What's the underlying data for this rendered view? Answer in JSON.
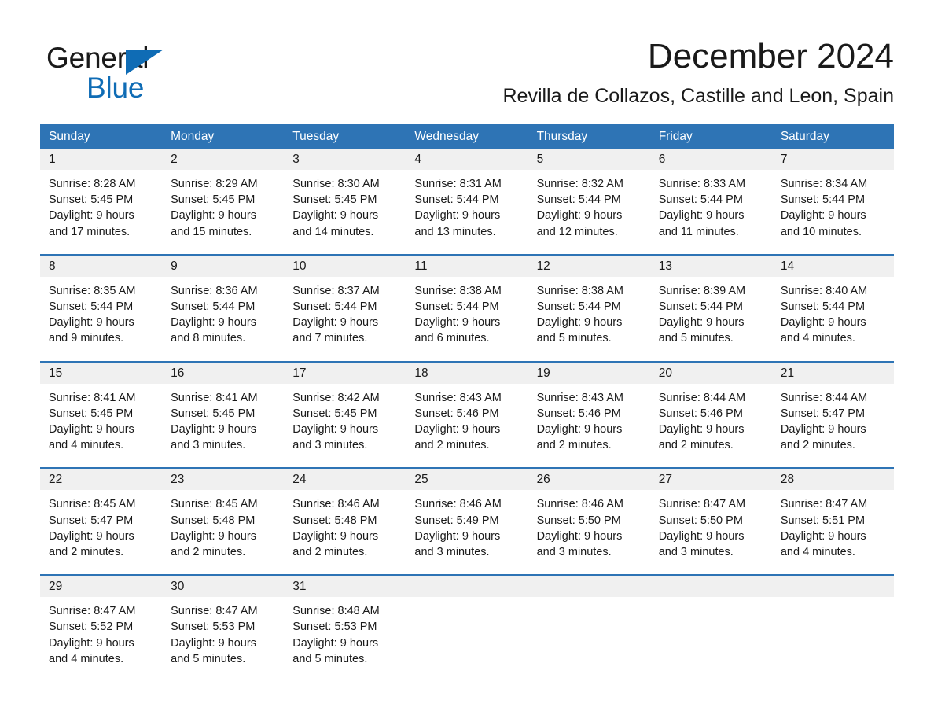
{
  "brand": {
    "name_part1": "General",
    "name_part2": "Blue",
    "triangle_icon": "blue-triangle-icon",
    "accent_color": "#0f6cb5"
  },
  "header": {
    "title": "December 2024",
    "subtitle": "Revilla de Collazos, Castille and Leon, Spain"
  },
  "colors": {
    "header_blue": "#2e74b5",
    "day_band_gray": "#f0f0f0",
    "text": "#1a1a1a",
    "header_text": "#ffffff"
  },
  "calendar": {
    "weekdays": [
      "Sunday",
      "Monday",
      "Tuesday",
      "Wednesday",
      "Thursday",
      "Friday",
      "Saturday"
    ],
    "weeks": [
      [
        {
          "day": "1",
          "sunrise": "Sunrise: 8:28 AM",
          "sunset": "Sunset: 5:45 PM",
          "daylight1": "Daylight: 9 hours",
          "daylight2": "and 17 minutes."
        },
        {
          "day": "2",
          "sunrise": "Sunrise: 8:29 AM",
          "sunset": "Sunset: 5:45 PM",
          "daylight1": "Daylight: 9 hours",
          "daylight2": "and 15 minutes."
        },
        {
          "day": "3",
          "sunrise": "Sunrise: 8:30 AM",
          "sunset": "Sunset: 5:45 PM",
          "daylight1": "Daylight: 9 hours",
          "daylight2": "and 14 minutes."
        },
        {
          "day": "4",
          "sunrise": "Sunrise: 8:31 AM",
          "sunset": "Sunset: 5:44 PM",
          "daylight1": "Daylight: 9 hours",
          "daylight2": "and 13 minutes."
        },
        {
          "day": "5",
          "sunrise": "Sunrise: 8:32 AM",
          "sunset": "Sunset: 5:44 PM",
          "daylight1": "Daylight: 9 hours",
          "daylight2": "and 12 minutes."
        },
        {
          "day": "6",
          "sunrise": "Sunrise: 8:33 AM",
          "sunset": "Sunset: 5:44 PM",
          "daylight1": "Daylight: 9 hours",
          "daylight2": "and 11 minutes."
        },
        {
          "day": "7",
          "sunrise": "Sunrise: 8:34 AM",
          "sunset": "Sunset: 5:44 PM",
          "daylight1": "Daylight: 9 hours",
          "daylight2": "and 10 minutes."
        }
      ],
      [
        {
          "day": "8",
          "sunrise": "Sunrise: 8:35 AM",
          "sunset": "Sunset: 5:44 PM",
          "daylight1": "Daylight: 9 hours",
          "daylight2": "and 9 minutes."
        },
        {
          "day": "9",
          "sunrise": "Sunrise: 8:36 AM",
          "sunset": "Sunset: 5:44 PM",
          "daylight1": "Daylight: 9 hours",
          "daylight2": "and 8 minutes."
        },
        {
          "day": "10",
          "sunrise": "Sunrise: 8:37 AM",
          "sunset": "Sunset: 5:44 PM",
          "daylight1": "Daylight: 9 hours",
          "daylight2": "and 7 minutes."
        },
        {
          "day": "11",
          "sunrise": "Sunrise: 8:38 AM",
          "sunset": "Sunset: 5:44 PM",
          "daylight1": "Daylight: 9 hours",
          "daylight2": "and 6 minutes."
        },
        {
          "day": "12",
          "sunrise": "Sunrise: 8:38 AM",
          "sunset": "Sunset: 5:44 PM",
          "daylight1": "Daylight: 9 hours",
          "daylight2": "and 5 minutes."
        },
        {
          "day": "13",
          "sunrise": "Sunrise: 8:39 AM",
          "sunset": "Sunset: 5:44 PM",
          "daylight1": "Daylight: 9 hours",
          "daylight2": "and 5 minutes."
        },
        {
          "day": "14",
          "sunrise": "Sunrise: 8:40 AM",
          "sunset": "Sunset: 5:44 PM",
          "daylight1": "Daylight: 9 hours",
          "daylight2": "and 4 minutes."
        }
      ],
      [
        {
          "day": "15",
          "sunrise": "Sunrise: 8:41 AM",
          "sunset": "Sunset: 5:45 PM",
          "daylight1": "Daylight: 9 hours",
          "daylight2": "and 4 minutes."
        },
        {
          "day": "16",
          "sunrise": "Sunrise: 8:41 AM",
          "sunset": "Sunset: 5:45 PM",
          "daylight1": "Daylight: 9 hours",
          "daylight2": "and 3 minutes."
        },
        {
          "day": "17",
          "sunrise": "Sunrise: 8:42 AM",
          "sunset": "Sunset: 5:45 PM",
          "daylight1": "Daylight: 9 hours",
          "daylight2": "and 3 minutes."
        },
        {
          "day": "18",
          "sunrise": "Sunrise: 8:43 AM",
          "sunset": "Sunset: 5:46 PM",
          "daylight1": "Daylight: 9 hours",
          "daylight2": "and 2 minutes."
        },
        {
          "day": "19",
          "sunrise": "Sunrise: 8:43 AM",
          "sunset": "Sunset: 5:46 PM",
          "daylight1": "Daylight: 9 hours",
          "daylight2": "and 2 minutes."
        },
        {
          "day": "20",
          "sunrise": "Sunrise: 8:44 AM",
          "sunset": "Sunset: 5:46 PM",
          "daylight1": "Daylight: 9 hours",
          "daylight2": "and 2 minutes."
        },
        {
          "day": "21",
          "sunrise": "Sunrise: 8:44 AM",
          "sunset": "Sunset: 5:47 PM",
          "daylight1": "Daylight: 9 hours",
          "daylight2": "and 2 minutes."
        }
      ],
      [
        {
          "day": "22",
          "sunrise": "Sunrise: 8:45 AM",
          "sunset": "Sunset: 5:47 PM",
          "daylight1": "Daylight: 9 hours",
          "daylight2": "and 2 minutes."
        },
        {
          "day": "23",
          "sunrise": "Sunrise: 8:45 AM",
          "sunset": "Sunset: 5:48 PM",
          "daylight1": "Daylight: 9 hours",
          "daylight2": "and 2 minutes."
        },
        {
          "day": "24",
          "sunrise": "Sunrise: 8:46 AM",
          "sunset": "Sunset: 5:48 PM",
          "daylight1": "Daylight: 9 hours",
          "daylight2": "and 2 minutes."
        },
        {
          "day": "25",
          "sunrise": "Sunrise: 8:46 AM",
          "sunset": "Sunset: 5:49 PM",
          "daylight1": "Daylight: 9 hours",
          "daylight2": "and 3 minutes."
        },
        {
          "day": "26",
          "sunrise": "Sunrise: 8:46 AM",
          "sunset": "Sunset: 5:50 PM",
          "daylight1": "Daylight: 9 hours",
          "daylight2": "and 3 minutes."
        },
        {
          "day": "27",
          "sunrise": "Sunrise: 8:47 AM",
          "sunset": "Sunset: 5:50 PM",
          "daylight1": "Daylight: 9 hours",
          "daylight2": "and 3 minutes."
        },
        {
          "day": "28",
          "sunrise": "Sunrise: 8:47 AM",
          "sunset": "Sunset: 5:51 PM",
          "daylight1": "Daylight: 9 hours",
          "daylight2": "and 4 minutes."
        }
      ],
      [
        {
          "day": "29",
          "sunrise": "Sunrise: 8:47 AM",
          "sunset": "Sunset: 5:52 PM",
          "daylight1": "Daylight: 9 hours",
          "daylight2": "and 4 minutes."
        },
        {
          "day": "30",
          "sunrise": "Sunrise: 8:47 AM",
          "sunset": "Sunset: 5:53 PM",
          "daylight1": "Daylight: 9 hours",
          "daylight2": "and 5 minutes."
        },
        {
          "day": "31",
          "sunrise": "Sunrise: 8:48 AM",
          "sunset": "Sunset: 5:53 PM",
          "daylight1": "Daylight: 9 hours",
          "daylight2": "and 5 minutes."
        },
        {
          "day": "",
          "sunrise": "",
          "sunset": "",
          "daylight1": "",
          "daylight2": ""
        },
        {
          "day": "",
          "sunrise": "",
          "sunset": "",
          "daylight1": "",
          "daylight2": ""
        },
        {
          "day": "",
          "sunrise": "",
          "sunset": "",
          "daylight1": "",
          "daylight2": ""
        },
        {
          "day": "",
          "sunrise": "",
          "sunset": "",
          "daylight1": "",
          "daylight2": ""
        }
      ]
    ]
  }
}
